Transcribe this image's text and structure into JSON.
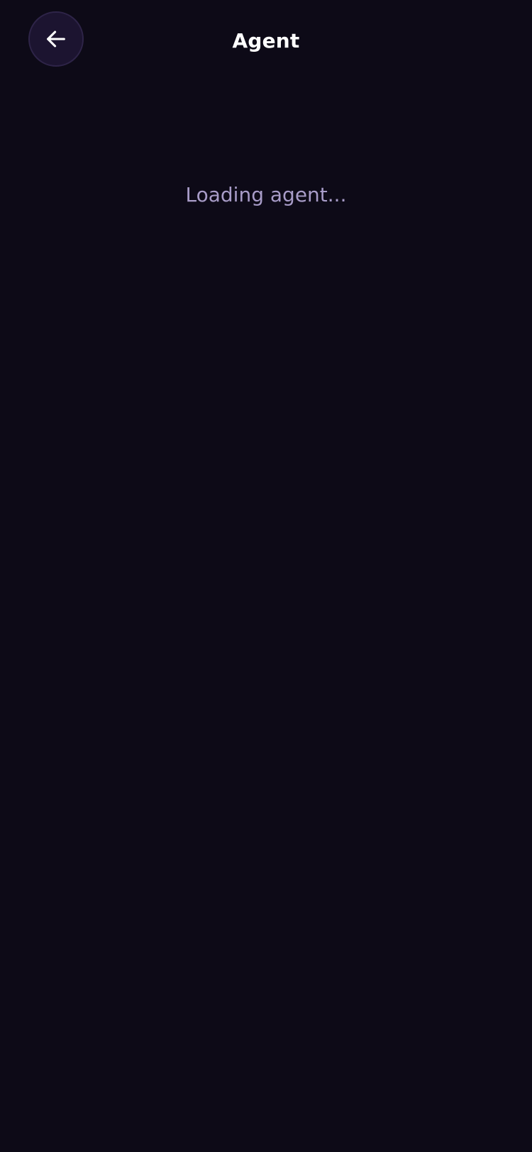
{
  "header": {
    "title": "Agent",
    "back_icon": "arrow-left-icon"
  },
  "main": {
    "status_text": "Loading agent..."
  },
  "colors": {
    "background": "#0d0a17",
    "back_button_bg": "#1c1430",
    "title": "#ffffff",
    "status_text": "#a89cc8"
  }
}
